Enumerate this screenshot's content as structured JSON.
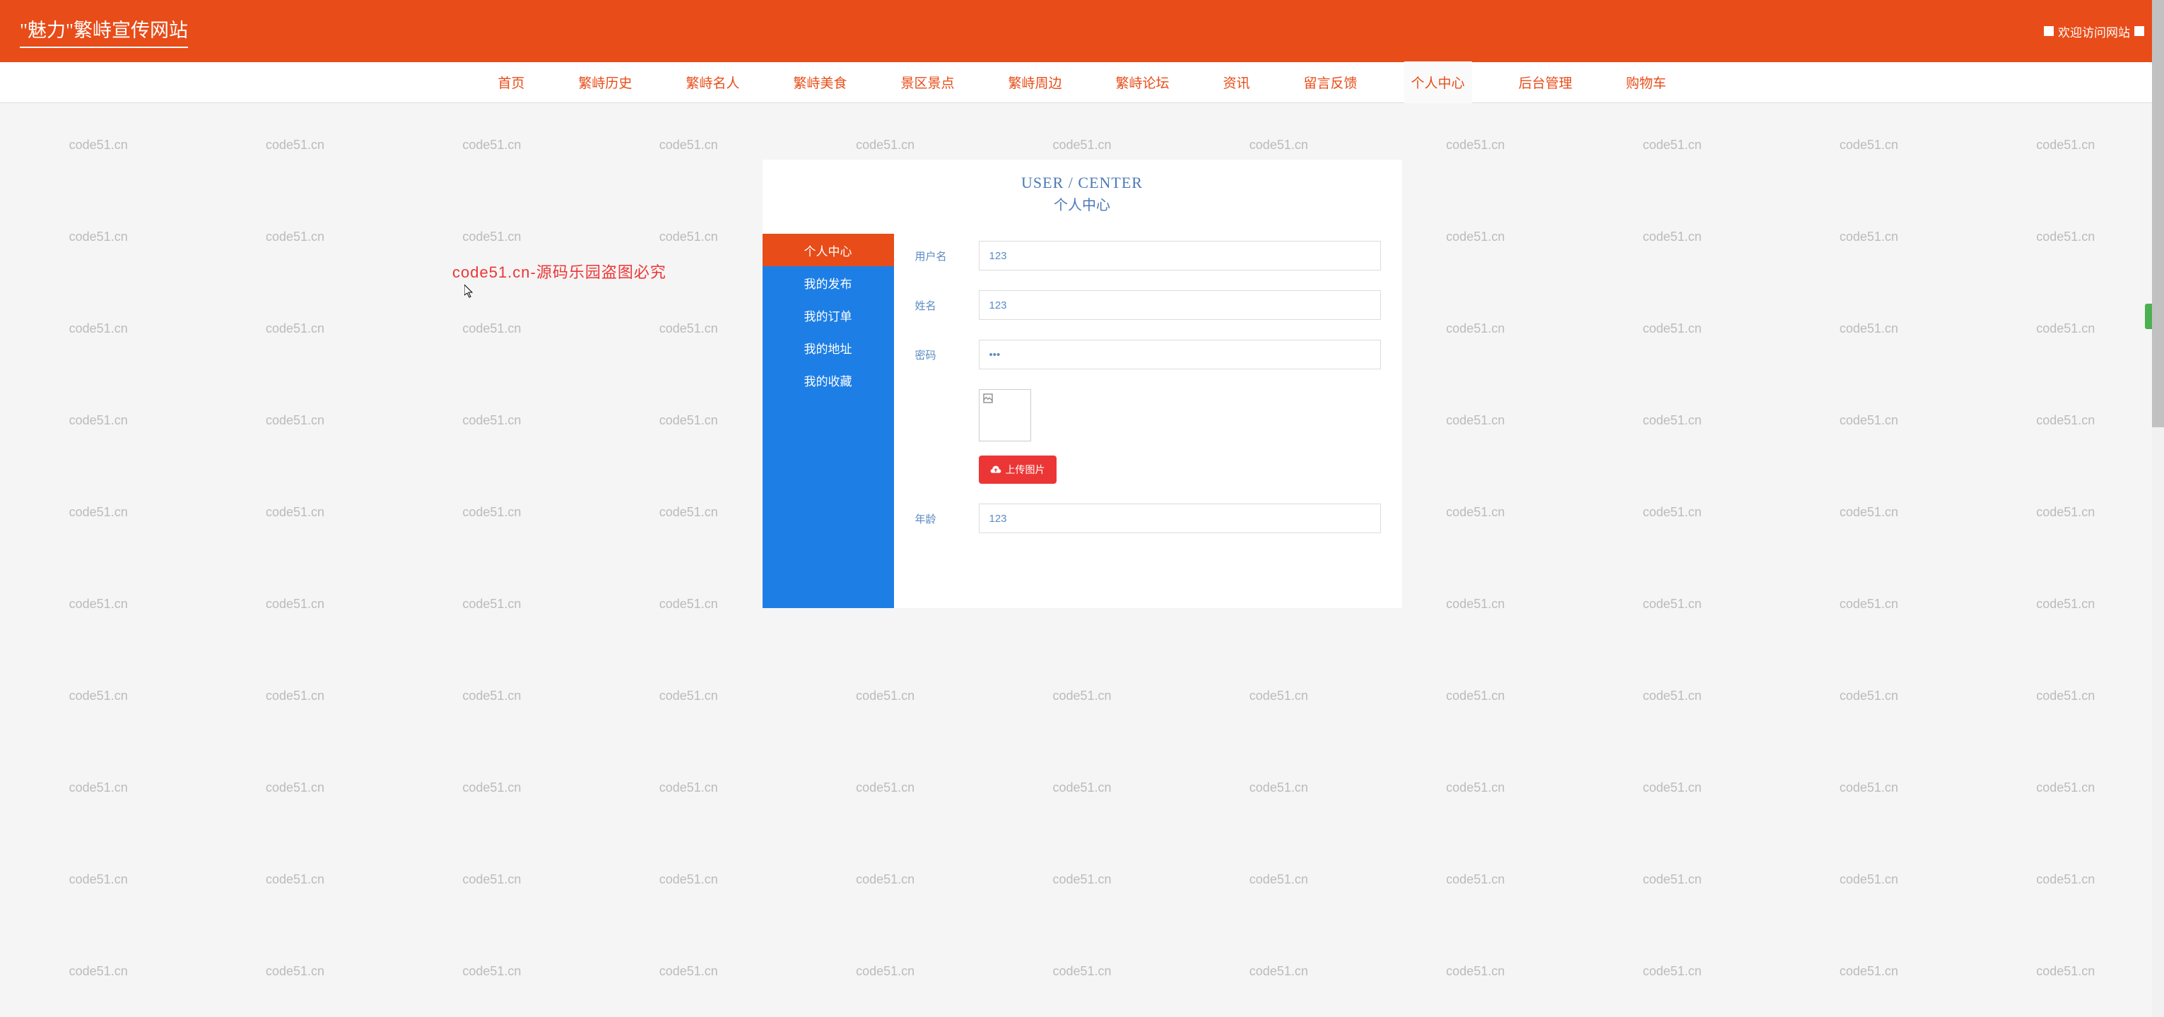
{
  "header": {
    "site_title": "\"魅力\"繁峙宣传网站",
    "welcome": "欢迎访问网站"
  },
  "nav": {
    "items": [
      "首页",
      "繁峙历史",
      "繁峙名人",
      "繁峙美食",
      "景区景点",
      "繁峙周边",
      "繁峙论坛",
      "资讯",
      "留言反馈",
      "个人中心",
      "后台管理",
      "购物车"
    ],
    "active_index": 9
  },
  "panel": {
    "title_en": "USER / CENTER",
    "title_cn": "个人中心"
  },
  "sidebar": {
    "items": [
      "个人中心",
      "我的发布",
      "我的订单",
      "我的地址",
      "我的收藏"
    ],
    "active_index": 0
  },
  "form": {
    "username_label": "用户名",
    "username_value": "123",
    "name_label": "姓名",
    "name_value": "123",
    "password_label": "密码",
    "password_value": "123",
    "upload_label": "上传图片",
    "age_label": "年龄",
    "age_value": "123"
  },
  "watermark": {
    "text": "code51.cn",
    "red_text": "code51.cn-源码乐园盗图必究"
  }
}
